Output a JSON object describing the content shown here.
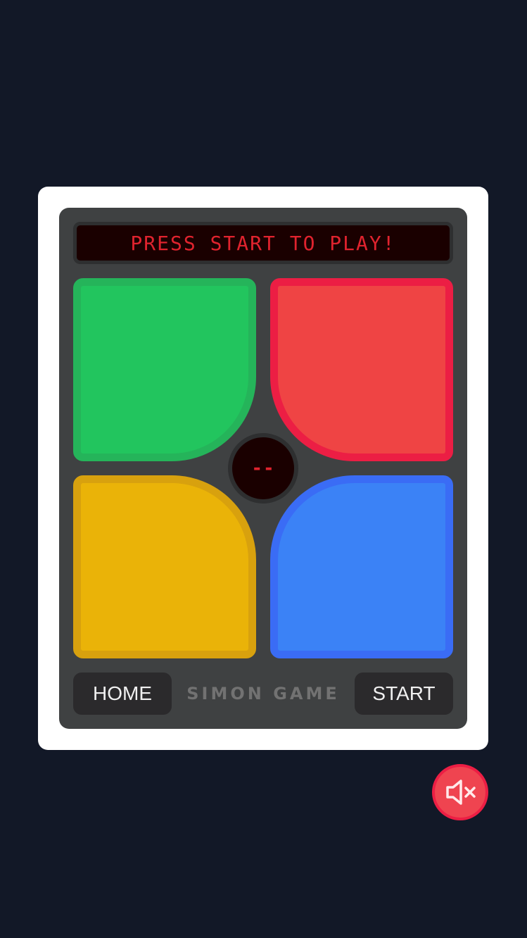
{
  "display": {
    "message": "PRESS START TO PLAY!"
  },
  "counter": {
    "value": "--"
  },
  "pads": [
    {
      "color_name": "green",
      "color": "#22c55e"
    },
    {
      "color_name": "red",
      "color": "#ef4444"
    },
    {
      "color_name": "yellow",
      "color": "#eab308"
    },
    {
      "color_name": "blue",
      "color": "#3b82f6"
    }
  ],
  "controls": {
    "home_label": "HOME",
    "title": "SIMON GAME",
    "start_label": "START"
  },
  "sound": {
    "icon": "speaker-muted-icon",
    "state": "muted"
  },
  "colors": {
    "background": "#121827",
    "console": "#3f4142",
    "display_text": "#e0232e",
    "mute_button": "#ef4450"
  }
}
